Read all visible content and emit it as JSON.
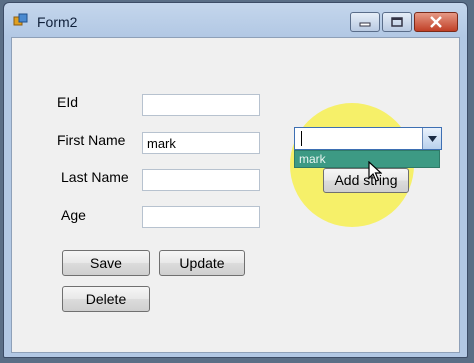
{
  "window": {
    "title": "Form2"
  },
  "form": {
    "eid_label": "EId",
    "first_name_label": "First Name",
    "last_name_label": "Last Name",
    "age_label": "Age",
    "eid_value": "",
    "first_name_value": "mark",
    "last_name_value": "",
    "age_value": ""
  },
  "buttons": {
    "save": "Save",
    "update": "Update",
    "delete": "Delete",
    "add_string": "Add string"
  },
  "combo": {
    "value": "",
    "dropdown_items": [
      "mark"
    ]
  },
  "colors": {
    "highlight": "#f8f03c",
    "dropdown_selected": "#3d9a84"
  }
}
